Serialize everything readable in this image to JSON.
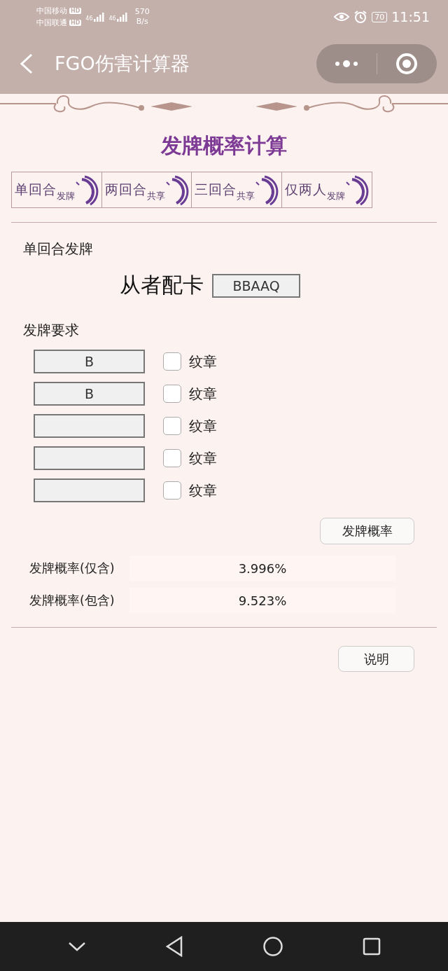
{
  "status_bar": {
    "carriers": [
      {
        "name": "中国移动",
        "badge": "HD",
        "network": "46"
      },
      {
        "name": "中国联通",
        "badge": "HD",
        "network": "46"
      }
    ],
    "speed": "570",
    "speed_unit": "B/s",
    "battery": "70",
    "time": "11:51"
  },
  "nav_bar": {
    "title": "FGO伤害计算器"
  },
  "page_title": "发牌概率计算",
  "tabs": [
    {
      "label": "单回合",
      "sub": "发牌"
    },
    {
      "label": "两回合",
      "sub": "共享"
    },
    {
      "label": "三回合",
      "sub": "共享"
    },
    {
      "label": "仅两人",
      "sub": "发牌"
    }
  ],
  "section_title": "单回合发牌",
  "servant_cards": {
    "label": "从者配卡",
    "value": "BBAAQ"
  },
  "requirements": {
    "title": "发牌要求",
    "rows": [
      {
        "value": "B",
        "label": "纹章",
        "checked": false
      },
      {
        "value": "B",
        "label": "纹章",
        "checked": false
      },
      {
        "value": "",
        "label": "纹章",
        "checked": false
      },
      {
        "value": "",
        "label": "纹章",
        "checked": false
      },
      {
        "value": "",
        "label": "纹章",
        "checked": false
      }
    ]
  },
  "calc_button": "发牌概率",
  "results": [
    {
      "label": "发牌概率(仅含)",
      "value": "3.996%"
    },
    {
      "label": "发牌概率(包含)",
      "value": "9.523%"
    }
  ],
  "help_button": "说明"
}
